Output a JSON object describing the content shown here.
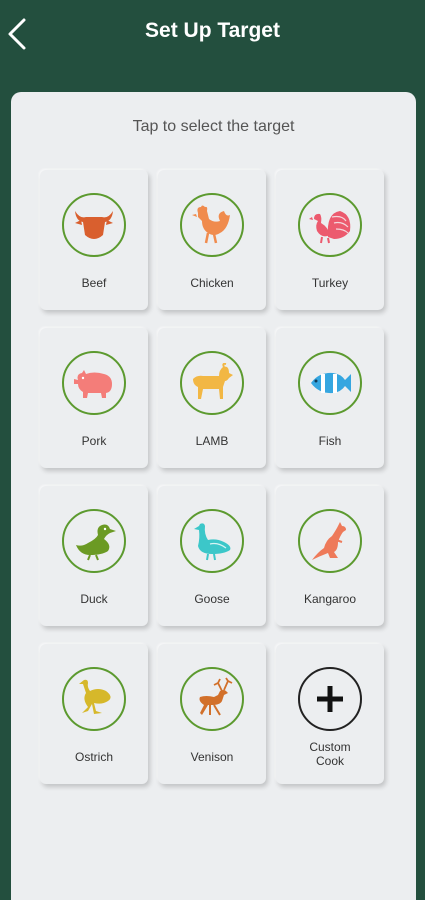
{
  "header": {
    "title": "Set Up Target"
  },
  "panel": {
    "subtitle": "Tap to select the target"
  },
  "targets": [
    {
      "label": "Beef",
      "icon": "cow-head-icon",
      "color": "#d95f2e"
    },
    {
      "label": "Chicken",
      "icon": "rooster-icon",
      "color": "#f08b4d"
    },
    {
      "label": "Turkey",
      "icon": "turkey-icon",
      "color": "#ec5a6e"
    },
    {
      "label": "Pork",
      "icon": "pig-icon",
      "color": "#f47d79"
    },
    {
      "label": "LAMB",
      "icon": "goat-icon",
      "color": "#f2b744"
    },
    {
      "label": "Fish",
      "icon": "fish-icon",
      "color": "#35a6e0"
    },
    {
      "label": "Duck",
      "icon": "duck-icon",
      "color": "#6b9a24"
    },
    {
      "label": "Goose",
      "icon": "goose-icon",
      "color": "#3cc7c9"
    },
    {
      "label": "Kangaroo",
      "icon": "kangaroo-icon",
      "color": "#ee7a5a"
    },
    {
      "label": "Ostrich",
      "icon": "ostrich-icon",
      "color": "#d6b82a"
    },
    {
      "label": "Venison",
      "icon": "deer-icon",
      "color": "#d2702a"
    },
    {
      "label": "Custom Cook",
      "icon": "plus-icon",
      "color": "#111111"
    }
  ]
}
